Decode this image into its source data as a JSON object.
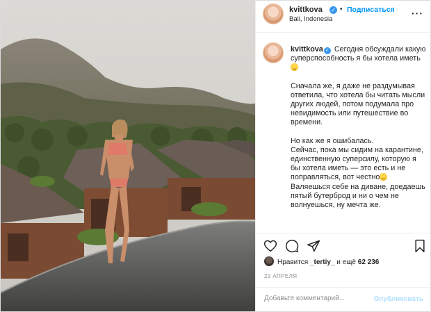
{
  "post": {
    "username": "kvittkova",
    "verified_mark": "✓",
    "dot": "•",
    "follow_label": "Подписаться",
    "location": "Bali, Indonesia",
    "more_icon": "more-horizontal-icon",
    "more_glyph": "···",
    "photo_alt": "photo"
  },
  "caption": {
    "username": "kvittkova",
    "paragraphs": [
      "Сегодня обсуждали какую суперспособность я бы хотела иметь",
      "Сначала же, я даже не раздумывая ответила, что хотела бы читать мысли других людей, потом подумала про невидимость или путешествие во времени.",
      "Но как же я ошибалась. Сейчас, пока мы сидим на карантине, единственную суперсилу, которую я бы хотела иметь — это есть и не поправляться, вот честно",
      "Валяешься себе на диване, доедаешь пятый бутерброд и ни о чем не волнуешься, ну мечта же."
    ],
    "p3_line1": "Но как же я ошибалась.",
    "p3_line2": "Сейчас, пока мы сидим на карантине,",
    "p3_line3": "единственную суперсилу, которую я бы хотела иметь — это есть и не поправляться, вот честно",
    "p4": "Валяешься себе на диване, доедаешь пятый бутерброд и ни о чем не волнуешься, ну мечта же."
  },
  "actions": {
    "icons": [
      "heart-icon",
      "comment-icon",
      "share-icon",
      "bookmark-icon"
    ]
  },
  "likes": {
    "prefix": "Нравится",
    "user": "_tertiy_",
    "middle": "и ещё",
    "count": "62 236"
  },
  "date": "22 АПРЕЛЯ",
  "comment": {
    "placeholder": "Добавьте комментарий...",
    "publish_label": "Опубликовать"
  },
  "colors": {
    "accent": "#0095f6",
    "verified": "#3897f0",
    "publish_disabled": "#b2dffc",
    "text": "#262626",
    "muted": "#8e8e8e"
  }
}
